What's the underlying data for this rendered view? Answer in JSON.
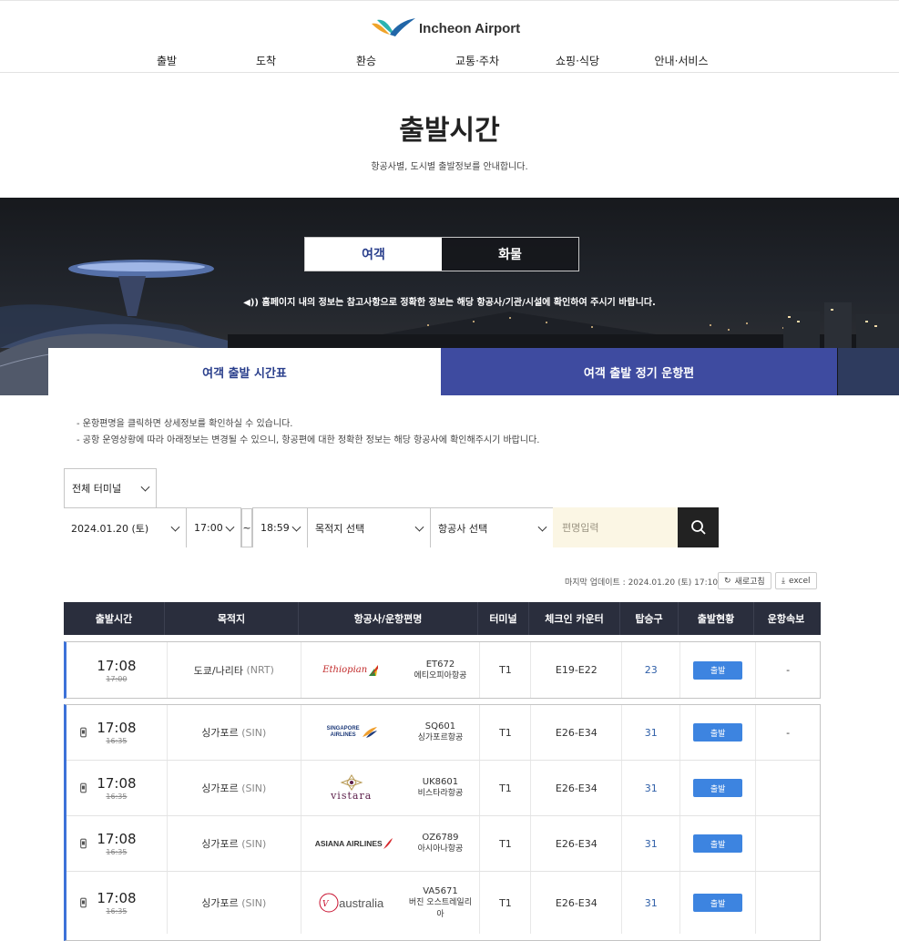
{
  "header": {
    "logo_text": "Incheon Airport",
    "nav": [
      "출발",
      "도착",
      "환승",
      "교통·주차",
      "쇼핑·식당",
      "안내·서비스"
    ]
  },
  "page": {
    "title": "출발시간",
    "subtitle": "항공사별, 도시별 출발정보를 안내합니다."
  },
  "hero": {
    "passenger_tab": "여객",
    "cargo_tab": "화물",
    "notice": "홈페이지 내의 정보는 참고사항으로 정확한 정보는 해당 항공사/기관/시설에 확인하여 주시기 바랍니다."
  },
  "subtabs": {
    "timetable": "여객 출발 시간표",
    "regular": "여객 출발 정기 운항편"
  },
  "guide": [
    "- 운항편명을 클릭하면 상세정보를 확인하실 수 있습니다.",
    "- 공항 운영상황에 따라 아래정보는 변경될 수 있으니, 항공편에 대한 정확한 정보는 해당 항공사에 확인해주시기 바랍니다."
  ],
  "filters": {
    "terminal": "전체 터미널",
    "date": "2024.01.20 (토)",
    "time_from": "17:00",
    "tilde": "~",
    "time_to": "18:59",
    "destination": "목적지 선택",
    "airline": "항공사 선택",
    "flight_placeholder": "편명입력"
  },
  "update": {
    "text": "마지막 업데이트 : 2024.01.20 (토) 17:10",
    "refresh": "새로고침",
    "excel": "excel"
  },
  "table": {
    "headers": [
      "출발시간",
      "목적지",
      "항공사/운항편명",
      "터미널",
      "체크인 카운터",
      "탑승구",
      "출발현황",
      "운항속보"
    ],
    "rows": [
      {
        "time": "17:08",
        "sched": "17:00",
        "dest": "도쿄/나리타",
        "code": "(NRT)",
        "logo": "Ethiopian",
        "flight": "ET672",
        "airline": "에티오피아항공",
        "terminal": "T1",
        "counter": "E19-E22",
        "gate": "23",
        "status": "출발",
        "news": "-"
      },
      {
        "time": "17:08",
        "sched": "16:35",
        "dest": "싱가포르",
        "code": "(SIN)",
        "logo": "SINGAPORE AIRLINES",
        "flight": "SQ601",
        "airline": "싱가포르항공",
        "terminal": "T1",
        "counter": "E26-E34",
        "gate": "31",
        "status": "출발",
        "news": "-"
      },
      {
        "time": "17:08",
        "sched": "16:35",
        "dest": "싱가포르",
        "code": "(SIN)",
        "logo": "vistara",
        "flight": "UK8601",
        "airline": "비스타라항공",
        "terminal": "T1",
        "counter": "E26-E34",
        "gate": "31",
        "status": "출발",
        "news": ""
      },
      {
        "time": "17:08",
        "sched": "16:35",
        "dest": "싱가포르",
        "code": "(SIN)",
        "logo": "ASIANA AIRLINES",
        "flight": "OZ6789",
        "airline": "아시아나항공",
        "terminal": "T1",
        "counter": "E26-E34",
        "gate": "31",
        "status": "출발",
        "news": ""
      },
      {
        "time": "17:08",
        "sched": "16:35",
        "dest": "싱가포르",
        "code": "(SIN)",
        "logo": "australia",
        "flight": "VA5671",
        "airline": "버진 오스트레일리아",
        "terminal": "T1",
        "counter": "E26-E34",
        "gate": "31",
        "status": "출발",
        "news": ""
      }
    ]
  },
  "colors": {
    "primary_navy": "#2a3f8c",
    "tab_blue": "#3e4ba0",
    "status_blue": "#3d84e0",
    "header_dark": "#2a2e3d"
  }
}
